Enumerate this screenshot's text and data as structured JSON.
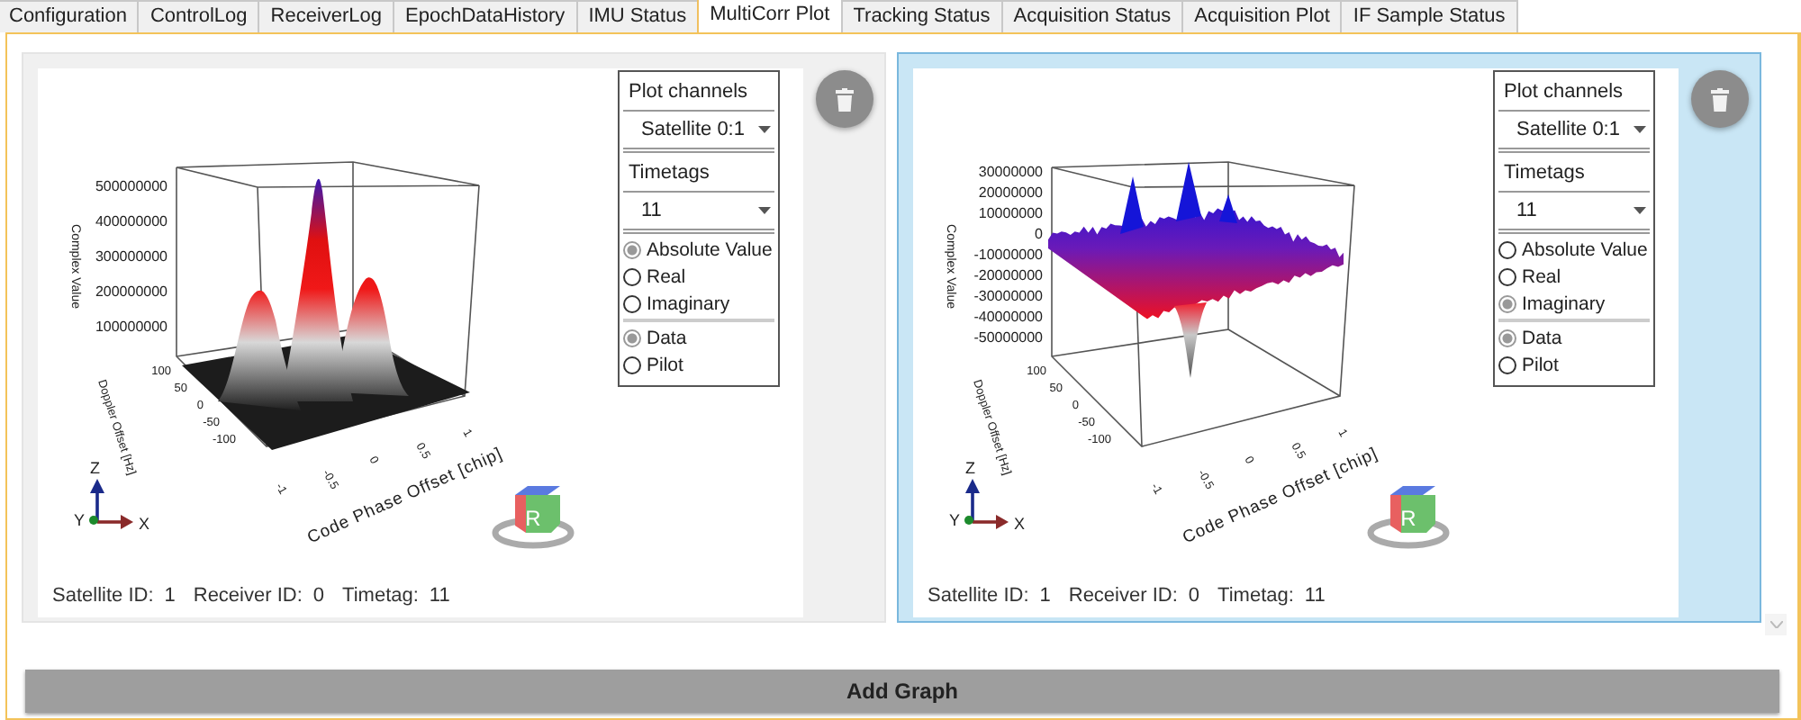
{
  "tabs": [
    {
      "label": "Configuration",
      "selected": false
    },
    {
      "label": "ControlLog",
      "selected": false
    },
    {
      "label": "ReceiverLog",
      "selected": false
    },
    {
      "label": "EpochDataHistory",
      "selected": false
    },
    {
      "label": "IMU Status",
      "selected": false
    },
    {
      "label": "MultiCorr Plot",
      "selected": true
    },
    {
      "label": "Tracking Status",
      "selected": false
    },
    {
      "label": "Acquisition Status",
      "selected": false
    },
    {
      "label": "Acquisition Plot",
      "selected": false
    },
    {
      "label": "IF Sample Status",
      "selected": false
    }
  ],
  "panels": [
    {
      "selected": false,
      "kind": "magnitude",
      "plot": {
        "z_title": "Complex Value",
        "z_ticks": [
          "500000000",
          "400000000",
          "300000000",
          "200000000",
          "100000000"
        ],
        "doppler_title": "Doppler Offset [Hz]",
        "doppler_ticks": [
          "100",
          "50",
          "0",
          "-50",
          "-100"
        ],
        "code_title": "Code Phase Offset [chip]",
        "code_ticks": [
          "-1",
          "-0.5",
          "0",
          "0.5",
          "1"
        ],
        "triad": [
          "Z",
          "Y",
          "X"
        ],
        "cube_label": "R"
      },
      "controls": {
        "channels_label": "Plot channels",
        "channel": "Satellite 0:1",
        "timetags_label": "Timetags",
        "timetag": "11",
        "value_modes": [
          {
            "label": "Absolute Value",
            "selected": true
          },
          {
            "label": "Real",
            "selected": false
          },
          {
            "label": "Imaginary",
            "selected": false
          }
        ],
        "sources": [
          {
            "label": "Data",
            "selected": true
          },
          {
            "label": "Pilot",
            "selected": false
          }
        ]
      },
      "info": [
        {
          "label": "Satellite ID:",
          "value": "1"
        },
        {
          "label": "Receiver ID:",
          "value": "0"
        },
        {
          "label": "Timetag:",
          "value": "11"
        }
      ]
    },
    {
      "selected": true,
      "kind": "signed",
      "plot": {
        "z_title": "Complex Value",
        "z_ticks": [
          "30000000",
          "20000000",
          "10000000",
          "0",
          "-10000000",
          "-20000000",
          "-30000000",
          "-40000000",
          "-50000000"
        ],
        "doppler_title": "Doppler Offset [Hz]",
        "doppler_ticks": [
          "100",
          "50",
          "0",
          "-50",
          "-100"
        ],
        "code_title": "Code Phase Offset [chip]",
        "code_ticks": [
          "-1",
          "-0.5",
          "0",
          "0.5",
          "1"
        ],
        "triad": [
          "Z",
          "Y",
          "X"
        ],
        "cube_label": "R"
      },
      "controls": {
        "channels_label": "Plot channels",
        "channel": "Satellite 0:1",
        "timetags_label": "Timetags",
        "timetag": "11",
        "value_modes": [
          {
            "label": "Absolute Value",
            "selected": false
          },
          {
            "label": "Real",
            "selected": false
          },
          {
            "label": "Imaginary",
            "selected": true
          }
        ],
        "sources": [
          {
            "label": "Data",
            "selected": true
          },
          {
            "label": "Pilot",
            "selected": false
          }
        ]
      },
      "info": [
        {
          "label": "Satellite ID:",
          "value": "1"
        },
        {
          "label": "Receiver ID:",
          "value": "0"
        },
        {
          "label": "Timetag:",
          "value": "11"
        }
      ]
    }
  ],
  "add_button": "Add Graph"
}
